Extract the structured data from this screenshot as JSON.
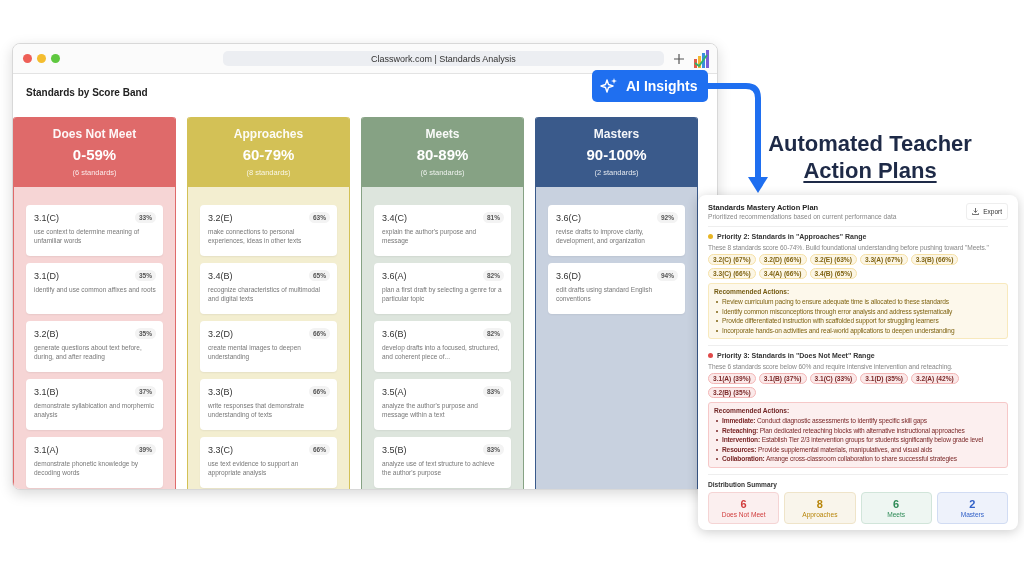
{
  "browser": {
    "url": "Classwork.com | Standards Analysis"
  },
  "heading": "Standards by Score Band",
  "bands": [
    {
      "title": "Does Not Meet",
      "range": "0-59%",
      "count": "(6 standards)",
      "color": "#df6a6a",
      "cards": [
        {
          "code": "3.1(C)",
          "pct": "33%",
          "desc": "use context to determine meaning of unfamiliar words"
        },
        {
          "code": "3.1(D)",
          "pct": "35%",
          "desc": "identify and use common affixes and roots"
        },
        {
          "code": "3.2(B)",
          "pct": "35%",
          "desc": "generate questions about text before, during, and after reading"
        },
        {
          "code": "3.1(B)",
          "pct": "37%",
          "desc": "demonstrate syllabication and morphemic analysis"
        },
        {
          "code": "3.1(A)",
          "pct": "39%",
          "desc": "demonstrate phonetic knowledge by decoding words"
        }
      ]
    },
    {
      "title": "Approaches",
      "range": "60-79%",
      "count": "(8 standards)",
      "color": "#d3c156",
      "cards": [
        {
          "code": "3.2(E)",
          "pct": "63%",
          "desc": "make connections to personal experiences, ideas in other texts"
        },
        {
          "code": "3.4(B)",
          "pct": "65%",
          "desc": "recognize characteristics of multimodal and digital texts"
        },
        {
          "code": "3.2(D)",
          "pct": "66%",
          "desc": "create mental images to deepen understanding"
        },
        {
          "code": "3.3(B)",
          "pct": "66%",
          "desc": "write responses that demonstrate understanding of texts"
        },
        {
          "code": "3.3(C)",
          "pct": "66%",
          "desc": "use text evidence to support an appropriate analysis"
        }
      ]
    },
    {
      "title": "Meets",
      "range": "80-89%",
      "count": "(6 standards)",
      "color": "#86a284",
      "cards": [
        {
          "code": "3.4(C)",
          "pct": "81%",
          "desc": "explain the author's purpose and message"
        },
        {
          "code": "3.6(A)",
          "pct": "82%",
          "desc": "plan a first draft by selecting a genre for a particular topic"
        },
        {
          "code": "3.6(B)",
          "pct": "82%",
          "desc": "develop drafts into a focused, structured, and coherent piece of..."
        },
        {
          "code": "3.5(A)",
          "pct": "83%",
          "desc": "analyze the author's purpose and message within a text"
        },
        {
          "code": "3.5(B)",
          "pct": "83%",
          "desc": "analyze use of text structure to achieve the author's purpose"
        }
      ]
    },
    {
      "title": "Masters",
      "range": "90-100%",
      "count": "(2 standards)",
      "color": "#3a5a8b",
      "cards": [
        {
          "code": "3.6(C)",
          "pct": "92%",
          "desc": "revise drafts to improve clarity, development, and organization"
        },
        {
          "code": "3.6(D)",
          "pct": "94%",
          "desc": "edit drafts using standard English conventions"
        }
      ]
    }
  ],
  "ai_button": "AI Insights",
  "headline": {
    "line1": "Automated Teacher",
    "line2": "Action Plans"
  },
  "plan": {
    "title": "Standards Mastery Action Plan",
    "subtitle": "Prioritized recommendations based on current performance data",
    "export": "Export",
    "priorities": [
      {
        "title": "Priority 2: Standards in \"Approaches\" Range",
        "color": "#e8b523",
        "description": "These 8 standards score 60-74%. Build foundational understanding before pushing toward \"Meets.\"",
        "chips": [
          "3.2(C) (67%)",
          "3.2(D) (66%)",
          "3.2(E) (63%)",
          "3.3(A) (67%)",
          "3.3(B) (66%)",
          "3.3(C) (66%)",
          "3.4(A) (66%)",
          "3.4(B) (65%)"
        ],
        "actions_heading": "Recommended Actions:",
        "actions": [
          "Review curriculum pacing to ensure adequate time is allocated to these standards",
          "Identify common misconceptions through error analysis and address systematically",
          "Provide differentiated instruction with scaffolded support for struggling learners",
          "Incorporate hands-on activities and real-world applications to deepen understanding"
        ]
      },
      {
        "title": "Priority 3: Standards in \"Does Not Meet\" Range",
        "color": "#e04848",
        "description": "These 6 standards score below 60% and require intensive intervention and reteaching.",
        "chips": [
          "3.1(A) (39%)",
          "3.1(B) (37%)",
          "3.1(C) (33%)",
          "3.1(D) (35%)",
          "3.2(A) (42%)",
          "3.2(B) (35%)"
        ],
        "actions_heading": "Recommended Actions:",
        "actions": [
          "**Immediate:** Conduct diagnostic assessments to identify specific skill gaps",
          "**Reteaching:** Plan dedicated reteaching blocks with alternative instructional approaches",
          "**Intervention:** Establish Tier 2/3 intervention groups for students significantly below grade level",
          "**Resources:** Provide supplemental materials, manipulatives, and visual aids",
          "**Collaboration:** Arrange cross-classroom collaboration to share successful strategies"
        ]
      }
    ],
    "summary_heading": "Distribution Summary",
    "summary": [
      {
        "count": "6",
        "label": "Does Not Meet",
        "color": "#d13c3c"
      },
      {
        "count": "8",
        "label": "Approaches",
        "color": "#b8860b"
      },
      {
        "count": "6",
        "label": "Meets",
        "color": "#2e8b57"
      },
      {
        "count": "2",
        "label": "Masters",
        "color": "#2f5fc7"
      }
    ]
  }
}
